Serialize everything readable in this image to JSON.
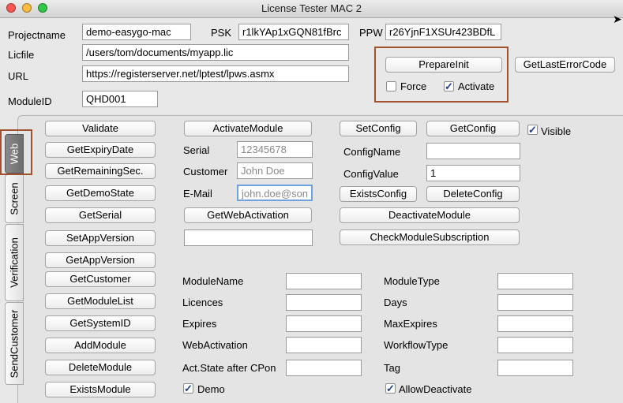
{
  "window": {
    "title": "License Tester MAC 2"
  },
  "header": {
    "projectname_label": "Projectname",
    "projectname_value": "demo-easygo-mac",
    "psk_label": "PSK",
    "psk_value": "r1lkYAp1xGQN81fBrc",
    "ppw_label": "PPW",
    "ppw_value": "r26YjnF1XSUr423BDfL",
    "licfile_label": "Licfile",
    "licfile_value": "/users/tom/documents/myapp.lic",
    "url_label": "URL",
    "url_value": "https://registerserver.net/lptest/lpws.asmx",
    "moduleid_label": "ModuleID",
    "moduleid_value": "QHD001",
    "prepareinit_label": "PrepareInit",
    "getlasterror_label": "GetLastErrorCode",
    "force_label": "Force",
    "force_checked": false,
    "activate_label": "Activate",
    "activate_checked": true
  },
  "tabs": [
    {
      "label": "Web",
      "selected": true
    },
    {
      "label": "Screen",
      "selected": false
    },
    {
      "label": "Verification",
      "selected": false
    },
    {
      "label": "SendCustomer",
      "selected": false
    }
  ],
  "left_buttons": [
    "Validate",
    "GetExpiryDate",
    "GetRemainingSec.",
    "GetDemoState",
    "GetSerial",
    "SetAppVersion",
    "GetAppVersion",
    "GetCustomer",
    "GetModuleList",
    "GetSystemID",
    "AddModule",
    "DeleteModule",
    "ExistsModule"
  ],
  "middle": {
    "activate_module_label": "ActivateModule",
    "serial_label": "Serial",
    "serial_placeholder": "12345678",
    "customer_label": "Customer",
    "customer_placeholder": "John Doe",
    "email_label": "E-Mail",
    "email_placeholder": "john.doe@son",
    "get_web_activation_label": "GetWebActivation",
    "extra_field_value": ""
  },
  "config": {
    "setconfig_label": "SetConfig",
    "getconfig_label": "GetConfig",
    "visible_label": "Visible",
    "visible_checked": true,
    "configname_label": "ConfigName",
    "configname_value": "",
    "configvalue_label": "ConfigValue",
    "configvalue_value": "1",
    "existsconfig_label": "ExistsConfig",
    "deleteconfig_label": "DeleteConfig",
    "deactivate_module_label": "DeactivateModule",
    "check_subscription_label": "CheckModuleSubscription"
  },
  "info": {
    "modulename_label": "ModuleName",
    "modulename_value": "",
    "licences_label": "Licences",
    "licences_value": "",
    "expires_label": "Expires",
    "expires_value": "",
    "webactivation_label": "WebActivation",
    "webactivation_value": "",
    "actstate_label": "Act.State after CPon",
    "actstate_value": "",
    "demo_label": "Demo",
    "demo_checked": true,
    "moduletype_label": "ModuleType",
    "moduletype_value": "",
    "days_label": "Days",
    "days_value": "",
    "maxexpires_label": "MaxExpires",
    "maxexpires_value": "",
    "workflowtype_label": "WorkflowType",
    "workflowtype_value": "",
    "tag_label": "Tag",
    "tag_value": "",
    "allowdeactivate_label": "AllowDeactivate",
    "allowdeactivate_checked": true
  },
  "colors": {
    "highlight": "#a0522d",
    "close": "#fc5753",
    "minimize": "#fdbc40",
    "zoom": "#33c748"
  }
}
